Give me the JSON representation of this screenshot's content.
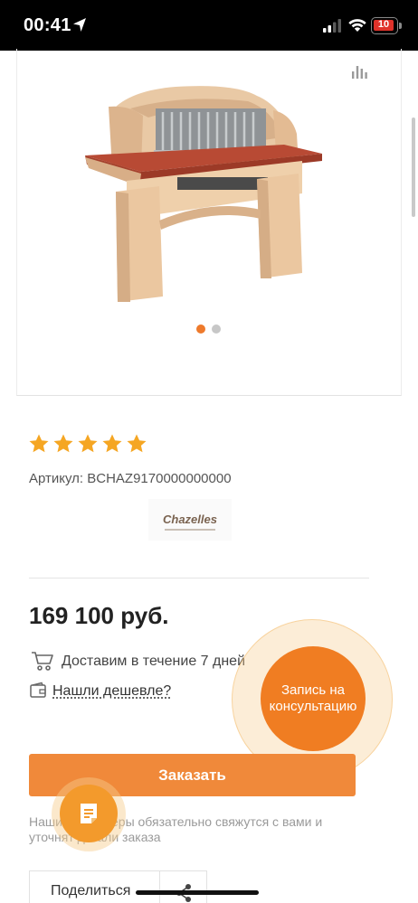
{
  "status_bar": {
    "time": "00:41",
    "battery_text": "10",
    "icons": [
      "location-arrow-icon",
      "signal-icon",
      "wifi-icon",
      "battery-icon"
    ]
  },
  "product": {
    "gallery": {
      "slide_count": 2,
      "active_slide": 1,
      "image_alt": "barbecue-grill-image",
      "compare_icon": "bar-chart-icon"
    },
    "rating": {
      "stars": 5,
      "max": 5,
      "color": "#f5a623"
    },
    "sku": "Артикул: BCHAZ9170000000000",
    "brand": "Chazelles",
    "price": "169 100 руб.",
    "delivery": "Доставим в течение 7 дней",
    "cheaper_link": "Нашли дешевле?",
    "order_button": "Заказать",
    "notice": "Наши менеджеры обязательно свяжутся с вами и уточнят детали заказа",
    "share_label": "Поделиться"
  },
  "floating": {
    "consult_label": "Запись на консультацию",
    "doc_icon": "document-icon"
  },
  "colors": {
    "accent": "#f0893a",
    "consult": "#f07d22",
    "star": "#f5a623"
  }
}
